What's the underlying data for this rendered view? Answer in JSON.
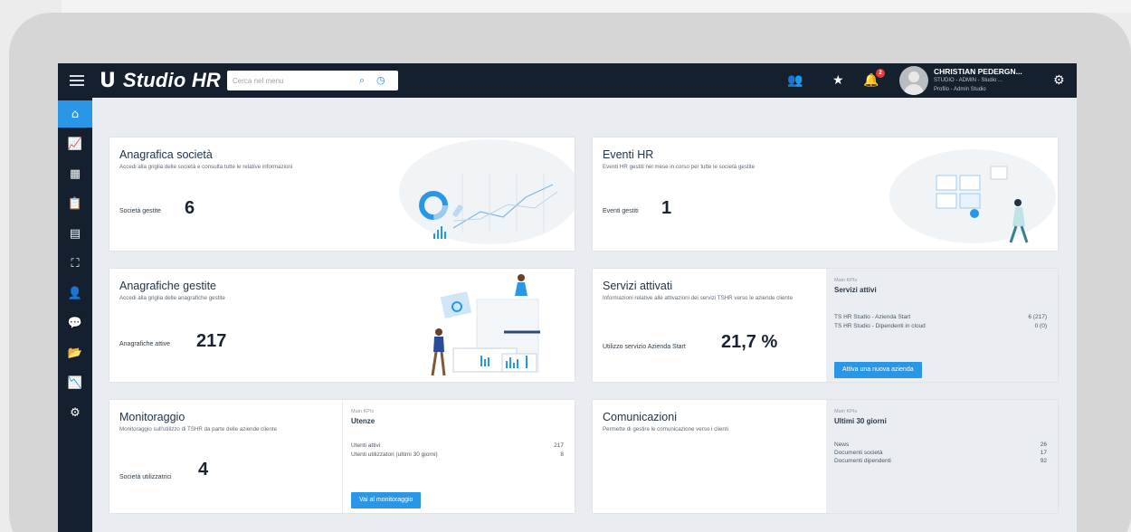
{
  "app": {
    "title": "Studio HR",
    "logo_mark": "U"
  },
  "search": {
    "placeholder": "Cerca nel menu"
  },
  "notifications": {
    "count": "2"
  },
  "user": {
    "name": "CHRISTIAN PEDERGN...",
    "role": "STUDIO - ADMIN - Studio ...",
    "profile": "Profilo - Admin Studio"
  },
  "icons": {
    "menu": "hamburger-icon",
    "search": "search-icon",
    "history": "clock-icon",
    "users": "users-icon",
    "favorites": "star-icon",
    "notifications": "bell-icon",
    "settings": "gear-icon"
  },
  "sidebar": {
    "items": [
      {
        "icon": "home-icon",
        "glyph": "⌂"
      },
      {
        "icon": "chart-icon",
        "glyph": "📈"
      },
      {
        "icon": "building-icon",
        "glyph": "▦"
      },
      {
        "icon": "clipboard-icon",
        "glyph": "📋"
      },
      {
        "icon": "list-icon",
        "glyph": "▤"
      },
      {
        "icon": "org-chart-icon",
        "glyph": "⛶"
      },
      {
        "icon": "user-check-icon",
        "glyph": "👤"
      },
      {
        "icon": "chat-icon",
        "glyph": "💬"
      },
      {
        "icon": "folder-icon",
        "glyph": "📂"
      },
      {
        "icon": "analytics-icon",
        "glyph": "📉"
      },
      {
        "icon": "settings-icon",
        "glyph": "⚙"
      }
    ]
  },
  "cards": {
    "anagrafica_societa": {
      "title": "Anagrafica società",
      "desc": "Accedi alla griglia delle società e consulta tutte le relative informazioni",
      "metric_label": "Società gestite",
      "metric_value": "6"
    },
    "eventi_hr": {
      "title": "Eventi HR",
      "desc": "Eventi HR gestiti nel mese in corso per tutte le società gestite",
      "metric_label": "Eventi gestiti",
      "metric_value": "1"
    },
    "anagrafiche_gestite": {
      "title": "Anagrafiche gestite",
      "desc": "Accedi alla griglia delle anagrafiche gestite",
      "metric_label": "Anagrafiche attive",
      "metric_value": "217"
    },
    "servizi_attivati": {
      "title": "Servizi attivati",
      "desc": "Informazioni relative alle attivazioni dei servizi TSHR verso le aziende cliente",
      "metric_label": "Utilizzo servizio Azienda Start",
      "metric_value": "21,7 %",
      "kpi": {
        "main": "Main KPIs",
        "title": "Servizi attivi",
        "rows": [
          {
            "label": "TS HR Studio - Azienda Start",
            "value": "6 (217)"
          },
          {
            "label": "TS HR Studio - Dipendenti in cloud",
            "value": "0 (0)"
          }
        ],
        "button": "Attiva una nuova azienda"
      }
    },
    "monitoraggio": {
      "title": "Monitoraggio",
      "desc": "Monitoraggio sull'utilizzo di TSHR da parte delle aziende cliente",
      "metric_label": "Società utilizzatrici",
      "metric_value": "4",
      "kpi": {
        "main": "Main KPIs",
        "title": "Utenze",
        "rows": [
          {
            "label": "Utenti attivi",
            "value": "217"
          },
          {
            "label": "Utenti utilizzatori (ultimi 30 giorni)",
            "value": "8"
          }
        ],
        "button": "Vai al monitoraggio"
      }
    },
    "comunicazioni": {
      "title": "Comunicazioni",
      "desc": "Permette di gestire le comunicazione verso i clienti",
      "kpi": {
        "main": "Main KPIs",
        "title": "Ultimi 30 giorni",
        "rows": [
          {
            "label": "News",
            "value": "26"
          },
          {
            "label": "Documenti società",
            "value": "17"
          },
          {
            "label": "Documenti dipendenti",
            "value": "92"
          }
        ]
      }
    }
  },
  "colors": {
    "nav_bg": "#14202d",
    "accent": "#2a97e6",
    "page_bg": "#e9edf1",
    "kpi_bg": "#eaeef2",
    "badge": "#e53935"
  }
}
